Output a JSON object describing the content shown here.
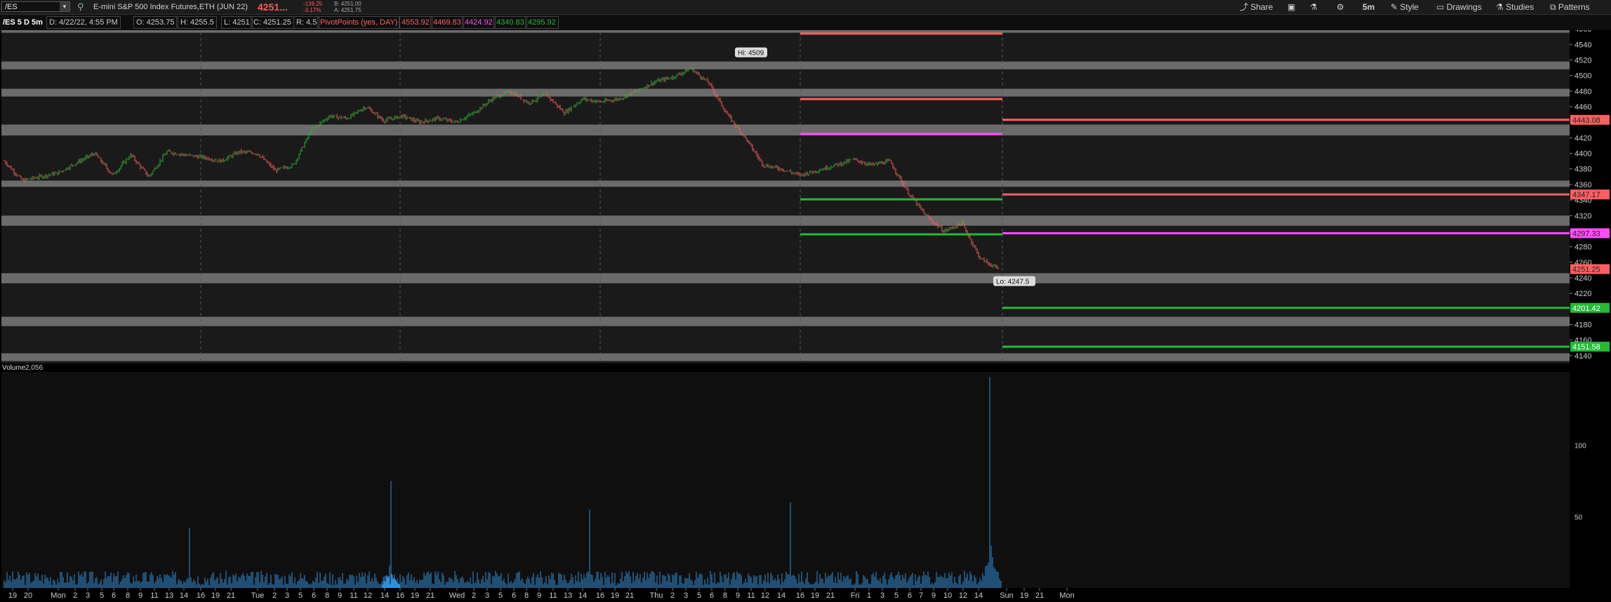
{
  "toolbar": {
    "symbol": "/ES",
    "description": "E-mini S&P 500 Index Futures,ETH (JUN 22)",
    "last_price": "4251...",
    "net_change": "-139.25",
    "pct_change": "-3.17%",
    "bid": "B: 4251.00",
    "ask": "A: 4251.75",
    "share_label": "Share",
    "timeframe_label": "5m",
    "style_label": "Style",
    "drawings_label": "Drawings",
    "studies_label": "Studies",
    "patterns_label": "Patterns"
  },
  "info": {
    "chart_label": "/ES 5 D 5m",
    "date": "D: 4/22/22, 4:55 PM",
    "open": "O: 4253.75",
    "high": "H: 4255.5",
    "low": "L: 4251",
    "close": "C: 4251.25",
    "range": "R: 4.5",
    "study_label": "PivotPoints (yes, DAY)",
    "pivot_values": [
      "4553.92",
      "4469.83",
      "4424.92",
      "4340.83",
      "4295.92"
    ]
  },
  "colors": {
    "background": "#1a1a1a",
    "zone": "#6b6b6b",
    "resistance": "#ff5f5f",
    "pivot": "#ff4dff",
    "support": "#22bb33",
    "candle_up": "#22bb33",
    "candle_down": "#ff5a5a",
    "volume": "#2f8fd8"
  },
  "chart_data": {
    "type": "candlestick",
    "symbol": "/ES",
    "interval": "5m",
    "ylim": [
      4130,
      4570
    ],
    "y_ticks": [
      4140,
      4160,
      4180,
      4200,
      4220,
      4240,
      4260,
      4280,
      4300,
      4320,
      4340,
      4360,
      4380,
      4400,
      4420,
      4440,
      4460,
      4480,
      4500,
      4520,
      4540,
      4560
    ],
    "x_tick_labels": [
      "19",
      "20",
      "Mon",
      "2",
      "3",
      "5",
      "6",
      "8",
      "9",
      "11",
      "13",
      "14",
      "16",
      "19",
      "21",
      "Tue",
      "2",
      "3",
      "5",
      "6",
      "8",
      "9",
      "11",
      "12",
      "14",
      "16",
      "19",
      "21",
      "Wed",
      "2",
      "3",
      "5",
      "6",
      "8",
      "9",
      "11",
      "13",
      "14",
      "16",
      "19",
      "21",
      "Thu",
      "2",
      "3",
      "5",
      "6",
      "8",
      "9",
      "11",
      "12",
      "14",
      "16",
      "19",
      "21",
      "Fri",
      "1",
      "3",
      "5",
      "6",
      "7",
      "9",
      "10",
      "12",
      "14",
      "Sun",
      "19",
      "21",
      "Mon"
    ],
    "day_separators": [
      "Mon",
      "Tue",
      "Wed",
      "Thu",
      "Fri",
      "Sun"
    ],
    "session_path": [
      [
        "Mon",
        4390
      ],
      [
        "Mon",
        4365
      ],
      [
        "Mon",
        4370
      ],
      [
        "Mon",
        4375
      ],
      [
        "Mon",
        4388
      ],
      [
        "Mon",
        4400
      ],
      [
        "Mon",
        4372
      ],
      [
        "Mon",
        4398
      ],
      [
        "Mon",
        4370
      ],
      [
        "Mon",
        4402
      ],
      [
        "Mon",
        4398
      ],
      [
        "Tue",
        4395
      ],
      [
        "Tue",
        4390
      ],
      [
        "Tue",
        4402
      ],
      [
        "Tue",
        4400
      ],
      [
        "Tue",
        4378
      ],
      [
        "Tue",
        4385
      ],
      [
        "Tue",
        4430
      ],
      [
        "Tue",
        4448
      ],
      [
        "Tue",
        4445
      ],
      [
        "Tue",
        4460
      ],
      [
        "Tue",
        4442
      ],
      [
        "Tue",
        4448
      ],
      [
        "Wed",
        4440
      ],
      [
        "Wed",
        4445
      ],
      [
        "Wed",
        4440
      ],
      [
        "Wed",
        4452
      ],
      [
        "Wed",
        4470
      ],
      [
        "Wed",
        4480
      ],
      [
        "Wed",
        4465
      ],
      [
        "Wed",
        4475
      ],
      [
        "Wed",
        4452
      ],
      [
        "Wed",
        4470
      ],
      [
        "Wed",
        4466
      ],
      [
        "Wed",
        4470
      ],
      [
        "Thu",
        4480
      ],
      [
        "Thu",
        4492
      ],
      [
        "Thu",
        4498
      ],
      [
        "Thu",
        4509
      ],
      [
        "Thu",
        4490
      ],
      [
        "Thu",
        4450
      ],
      [
        "Thu",
        4420
      ],
      [
        "Thu",
        4385
      ],
      [
        "Thu",
        4380
      ],
      [
        "Thu",
        4372
      ],
      [
        "Fri",
        4378
      ],
      [
        "Fri",
        4385
      ],
      [
        "Fri",
        4392
      ],
      [
        "Fri",
        4385
      ],
      [
        "Fri",
        4390
      ],
      [
        "Fri",
        4350
      ],
      [
        "Fri",
        4320
      ],
      [
        "Fri",
        4300
      ],
      [
        "Fri",
        4310
      ],
      [
        "Fri",
        4265
      ],
      [
        "Fri",
        4251.25
      ]
    ],
    "high_label": "Hi: 4509",
    "low_label": "Lo: 4247.5",
    "gray_zones": [
      [
        4555,
        4565
      ],
      [
        4508,
        4518
      ],
      [
        4473,
        4483
      ],
      [
        4423,
        4437
      ],
      [
        4357,
        4365
      ],
      [
        4307,
        4320
      ],
      [
        4233,
        4246
      ],
      [
        4178,
        4190
      ],
      [
        4133,
        4143
      ]
    ],
    "prior_pivots": [
      {
        "value": 4553.92,
        "kind": "resistance"
      },
      {
        "value": 4469.83,
        "kind": "resistance"
      },
      {
        "value": 4424.92,
        "kind": "pivot"
      },
      {
        "value": 4340.83,
        "kind": "support"
      },
      {
        "value": 4295.92,
        "kind": "support"
      }
    ],
    "next_pivots": [
      {
        "value": 4443.08,
        "label": "4443.08",
        "kind": "resistance"
      },
      {
        "value": 4347.17,
        "label": "4347.17",
        "kind": "resistance"
      },
      {
        "value": 4297.33,
        "label": "4297.33",
        "kind": "pivot"
      },
      {
        "value": 4201.42,
        "label": "4201.42",
        "kind": "support"
      },
      {
        "value": 4151.58,
        "label": "4151.58",
        "kind": "support"
      }
    ],
    "last_price_label": "4251.25",
    "volume": {
      "label": "Volume",
      "value": "2,056",
      "y_ticks": [
        "100",
        "50"
      ],
      "ylim": [
        0,
        150
      ],
      "spikes": [
        {
          "day": "Mon",
          "value": 42
        },
        {
          "day": "Tue",
          "value": 75
        },
        {
          "day": "Wed",
          "value": 55
        },
        {
          "day": "Thu",
          "value": 60
        },
        {
          "day": "Fri",
          "value": 148
        }
      ]
    }
  }
}
